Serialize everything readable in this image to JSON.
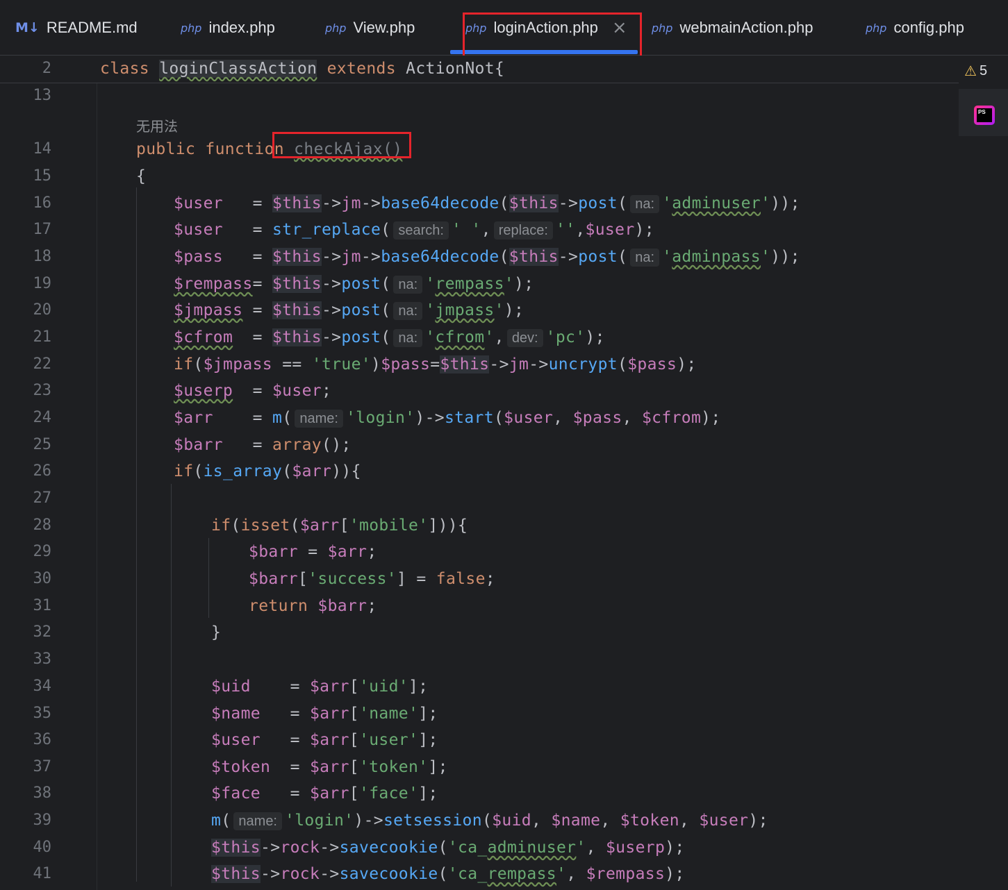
{
  "tabs": [
    {
      "icon": "M↓",
      "label": "README.md"
    },
    {
      "icon": "php",
      "label": "index.php"
    },
    {
      "icon": "php",
      "label": "View.php"
    },
    {
      "icon": "php",
      "label": "loginAction.php",
      "close": "×"
    },
    {
      "icon": "php",
      "label": "webmainAction.php"
    },
    {
      "icon": "php",
      "label": "config.php"
    }
  ],
  "warnings": {
    "count": "5"
  },
  "editor": {
    "line_numbers": [
      "2",
      "13",
      "14",
      "15",
      "16",
      "17",
      "18",
      "19",
      "20",
      "21",
      "22",
      "23",
      "24",
      "25",
      "26",
      "27",
      "28",
      "29",
      "30",
      "31",
      "32",
      "33",
      "34",
      "35",
      "36",
      "37",
      "38",
      "39",
      "40",
      "41"
    ],
    "comment": "无用法",
    "sticky": {
      "kw": "class",
      "name": "loginClassAction",
      "ext": "extends",
      "parent": "ActionNot{"
    },
    "code": {
      "l14_kw": "public function",
      "l14_fn": "checkAjax()",
      "l15": "{",
      "user": "$user",
      "pass": "$pass",
      "rempass": "$rempass",
      "jmpass": "$jmpass",
      "cfrom": "$cfrom",
      "userp": "$userp",
      "arr": "$arr",
      "barr": "$barr",
      "uid": "$uid",
      "name": "$name",
      "token": "$token",
      "face": "$face",
      "this": "$this",
      "hint_na": "na:",
      "hint_search": "search:",
      "hint_replace": "replace:",
      "hint_dev": "dev:",
      "hint_name": "name:"
    }
  },
  "colors": {
    "keyword": "#cf8e6d",
    "variable": "#c77dbb",
    "function": "#56a8f5",
    "string": "#6aab73",
    "accent": "#3574f0",
    "highlight_box": "#e5242b"
  }
}
